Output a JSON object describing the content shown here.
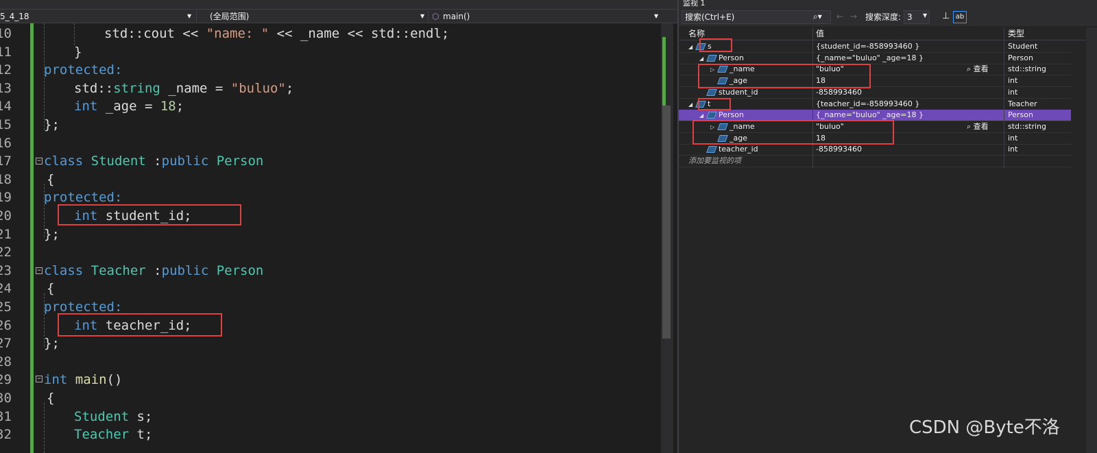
{
  "editor": {
    "file_tab": "5_4_18",
    "scope": "(全局范围)",
    "function": "main()",
    "lines": [
      {
        "n": "10",
        "tokens": [
          {
            "t": "std::cout << ",
            "c": "pl"
          },
          {
            "t": "\"name: \"",
            "c": "st"
          },
          {
            "t": " << _name << std::endl;",
            "c": "pl"
          }
        ]
      },
      {
        "n": "11",
        "tokens": [
          {
            "t": "}",
            "c": "pl"
          }
        ]
      },
      {
        "n": "12",
        "tokens": [
          {
            "t": "protected:",
            "c": "kw"
          }
        ]
      },
      {
        "n": "13",
        "tokens": [
          {
            "t": "std::",
            "c": "pl"
          },
          {
            "t": "string",
            "c": "ty"
          },
          {
            "t": " _name = ",
            "c": "pl"
          },
          {
            "t": "\"buluo\"",
            "c": "st"
          },
          {
            "t": ";",
            "c": "pl"
          }
        ]
      },
      {
        "n": "14",
        "tokens": [
          {
            "t": "int",
            "c": "kw"
          },
          {
            "t": " _age = ",
            "c": "pl"
          },
          {
            "t": "18",
            "c": "nu"
          },
          {
            "t": ";",
            "c": "pl"
          }
        ]
      },
      {
        "n": "15",
        "tokens": [
          {
            "t": "};",
            "c": "pl"
          }
        ]
      },
      {
        "n": "16",
        "tokens": []
      },
      {
        "n": "17",
        "tokens": [
          {
            "t": "class",
            "c": "kw"
          },
          {
            "t": " ",
            "c": "pl"
          },
          {
            "t": "Student",
            "c": "ty"
          },
          {
            "t": " :",
            "c": "pl"
          },
          {
            "t": "public",
            "c": "kw"
          },
          {
            "t": " ",
            "c": "pl"
          },
          {
            "t": "Person",
            "c": "ty"
          }
        ]
      },
      {
        "n": "18",
        "tokens": [
          {
            "t": "{",
            "c": "pl"
          }
        ]
      },
      {
        "n": "19",
        "tokens": [
          {
            "t": "protected:",
            "c": "kw"
          }
        ]
      },
      {
        "n": "20",
        "tokens": [
          {
            "t": "int",
            "c": "kw"
          },
          {
            "t": " student_id;",
            "c": "pl"
          }
        ]
      },
      {
        "n": "21",
        "tokens": [
          {
            "t": "};",
            "c": "pl"
          }
        ]
      },
      {
        "n": "22",
        "tokens": []
      },
      {
        "n": "23",
        "tokens": [
          {
            "t": "class",
            "c": "kw"
          },
          {
            "t": " ",
            "c": "pl"
          },
          {
            "t": "Teacher",
            "c": "ty"
          },
          {
            "t": " :",
            "c": "pl"
          },
          {
            "t": "public",
            "c": "kw"
          },
          {
            "t": " ",
            "c": "pl"
          },
          {
            "t": "Person",
            "c": "ty"
          }
        ]
      },
      {
        "n": "24",
        "tokens": [
          {
            "t": "{",
            "c": "pl"
          }
        ]
      },
      {
        "n": "25",
        "tokens": [
          {
            "t": "protected:",
            "c": "kw"
          }
        ]
      },
      {
        "n": "26",
        "tokens": [
          {
            "t": "int",
            "c": "kw"
          },
          {
            "t": " teacher_id;",
            "c": "pl"
          }
        ]
      },
      {
        "n": "27",
        "tokens": [
          {
            "t": "};",
            "c": "pl"
          }
        ]
      },
      {
        "n": "28",
        "tokens": []
      },
      {
        "n": "29",
        "tokens": [
          {
            "t": "int",
            "c": "kw"
          },
          {
            "t": " ",
            "c": "pl"
          },
          {
            "t": "main",
            "c": "fn"
          },
          {
            "t": "()",
            "c": "pl"
          }
        ]
      },
      {
        "n": "30",
        "tokens": [
          {
            "t": "{",
            "c": "pl"
          }
        ]
      },
      {
        "n": "31",
        "tokens": [
          {
            "t": "Student",
            "c": "ty"
          },
          {
            "t": " s;",
            "c": "pl"
          }
        ]
      },
      {
        "n": "32",
        "tokens": [
          {
            "t": "Teacher",
            "c": "ty"
          },
          {
            "t": " t;",
            "c": "pl"
          }
        ]
      }
    ]
  },
  "watch": {
    "title": "监视 1",
    "search_placeholder": "搜索(Ctrl+E)",
    "depth_label": "搜索深度:",
    "depth_value": "3",
    "headers": {
      "name": "名称",
      "value": "值",
      "type": "类型"
    },
    "view_label": "查看",
    "add_item": "添加要监视的项",
    "rows": [
      {
        "name": "s",
        "value": "{student_id=-858993460 }",
        "type": "Student",
        "expander": "◢"
      },
      {
        "name": "Person",
        "value": "{_name=\"buluo\" _age=18 }",
        "type": "Person",
        "expander": "◢"
      },
      {
        "name": "_name",
        "value": "\"buluo\"",
        "type": "std::string",
        "expander": "▷"
      },
      {
        "name": "_age",
        "value": "18",
        "type": "int",
        "expander": ""
      },
      {
        "name": "student_id",
        "value": "-858993460",
        "type": "int",
        "expander": ""
      },
      {
        "name": "t",
        "value": "{teacher_id=-858993460 }",
        "type": "Teacher",
        "expander": "◢"
      },
      {
        "name": "Person",
        "value": "{_name=\"buluo\" _age=18 }",
        "type": "Person",
        "expander": "◢"
      },
      {
        "name": "_name",
        "value": "\"buluo\"",
        "type": "std::string",
        "expander": "▷"
      },
      {
        "name": "_age",
        "value": "18",
        "type": "int",
        "expander": ""
      },
      {
        "name": "teacher_id",
        "value": "-858993460",
        "type": "int",
        "expander": ""
      }
    ]
  },
  "watermark": "CSDN @Byte不洛",
  "colors": {
    "keyword": "#569cd6",
    "type": "#4ec9b0",
    "string": "#d69d85",
    "number": "#b5cea8",
    "highlight_box": "#e04040",
    "selected_row": "#6e4ab8"
  }
}
